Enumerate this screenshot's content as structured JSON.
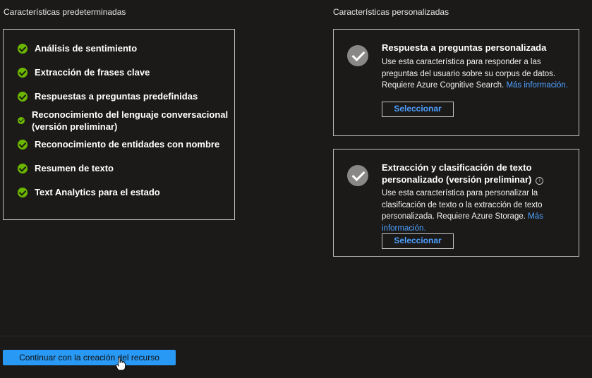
{
  "headings": {
    "default": "Características predeterminadas",
    "custom": "Características personalizadas"
  },
  "default_features": [
    "Análisis de sentimiento",
    "Extracción de frases clave",
    "Respuestas a preguntas predefinidas",
    "Reconocimiento del lenguaje conversacional",
    "(versión preliminar)",
    "Reconocimiento de entidades con nombre",
    "Resumen de texto",
    "Text Analytics para el estado"
  ],
  "custom_features": [
    {
      "title": "Respuesta a preguntas personalizada",
      "description": "Use esta característica para responder a las preguntas del usuario sobre su corpus de datos. Requiere Azure Cognitive Search.",
      "link": "Más información.",
      "button": "Seleccionar"
    },
    {
      "title": "Extracción y clasificación de texto personalizado (versión preliminar)",
      "description": "Use esta característica para personalizar la clasificación de texto o la extracción de texto personalizada. Requiere Azure Storage.",
      "link": "Más información.",
      "button": "Seleccionar",
      "info_icon": "info-icon"
    }
  ],
  "footer": {
    "continue_button": "Continuar con la creación del recurso"
  },
  "colors": {
    "background": "#1b1a19",
    "check_green": "#6bb700",
    "link_blue": "#4ea0ff",
    "primary_button": "#2899f5"
  }
}
